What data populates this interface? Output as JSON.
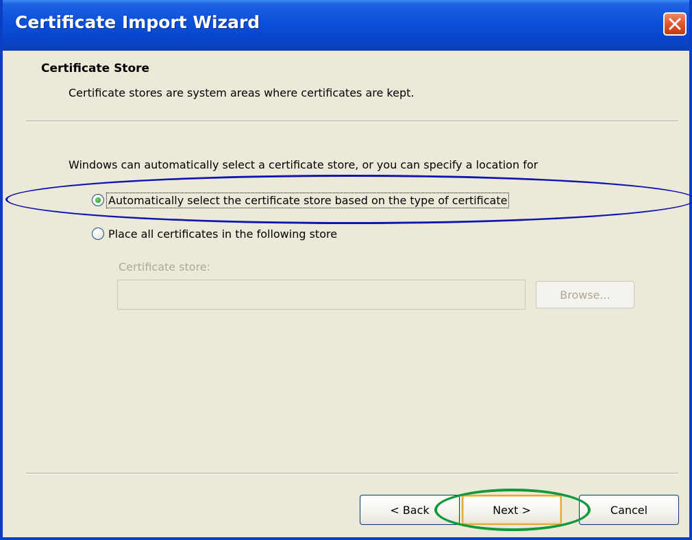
{
  "window": {
    "title": "Certificate Import Wizard",
    "close_icon": "close-x-icon"
  },
  "header": {
    "title": "Certificate Store",
    "subtitle": "Certificate stores are system areas where certificates are kept."
  },
  "body": {
    "intro": "Windows can automatically select a certificate store, or you can specify a location for",
    "options": [
      {
        "label": "Automatically select the certificate store based on the type of certificate",
        "selected": true
      },
      {
        "label": "Place all certificates in the following store",
        "selected": false
      }
    ],
    "store_label": "Certificate store:",
    "store_value": "",
    "browse_label": "Browse..."
  },
  "footer": {
    "back_label": "< Back",
    "next_label": "Next >",
    "cancel_label": "Cancel"
  },
  "colors": {
    "titlebar": "#0a47cf",
    "dialog_bg": "#ece9d8",
    "annotation_blue": "#0d14b0",
    "annotation_green": "#0f9a3a"
  }
}
